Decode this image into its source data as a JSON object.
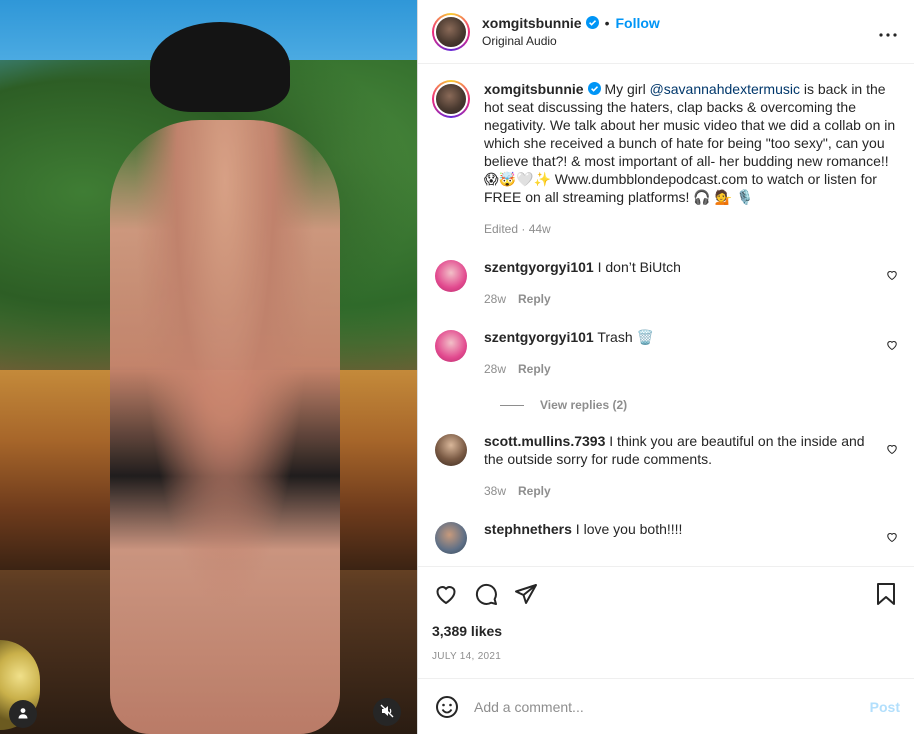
{
  "post": {
    "author": "xomgitsbunnie",
    "follow_label": "Follow",
    "separator": "•",
    "audio": "Original Audio",
    "more_label": "More options"
  },
  "caption": {
    "author": "xomgitsbunnie",
    "text_before": " My girl ",
    "mention": "@savannahdextermusic",
    "text_after": " is back in the hot seat discussing the haters, clap backs & overcoming the negativity. We talk about her music video that we did a collab on in which she received a bunch of hate for being \"too sexy\", can you believe that?! & most important of all- her budding new romance!! 😱🤯🤍✨ Www.dumbblondepodcast.com to watch or listen for FREE on all streaming platforms! 🎧 💁 🎙️",
    "meta": "Edited · 44w"
  },
  "comments": [
    {
      "user": "szentgyorgyi101",
      "text": " I don’t BiUtch",
      "time": "28w",
      "reply_label": "Reply"
    },
    {
      "user": "szentgyorgyi101",
      "text": " Trash 🗑️",
      "time": "28w",
      "reply_label": "Reply"
    },
    {
      "user": "scott.mullins.7393",
      "text": " I think you are beautiful on the inside and the outside sorry for rude comments.",
      "time": "38w",
      "reply_label": "Reply"
    },
    {
      "user": "stephnethers",
      "text": " I love you both!!!!"
    }
  ],
  "view_replies": "View replies (2)",
  "likes": "3,389 likes",
  "date": "July 14, 2021",
  "composer": {
    "placeholder": "Add a comment...",
    "post_label": "Post"
  },
  "colors": {
    "accent": "#0095f6",
    "link": "#00376b",
    "muted": "#8e8e8e",
    "post_disabled": "#b2dffc"
  },
  "icons": [
    "user-tag-icon",
    "mute-icon",
    "verified-badge-icon",
    "more-icon",
    "heart-icon",
    "comment-icon",
    "share-icon",
    "bookmark-icon",
    "emoji-icon"
  ]
}
